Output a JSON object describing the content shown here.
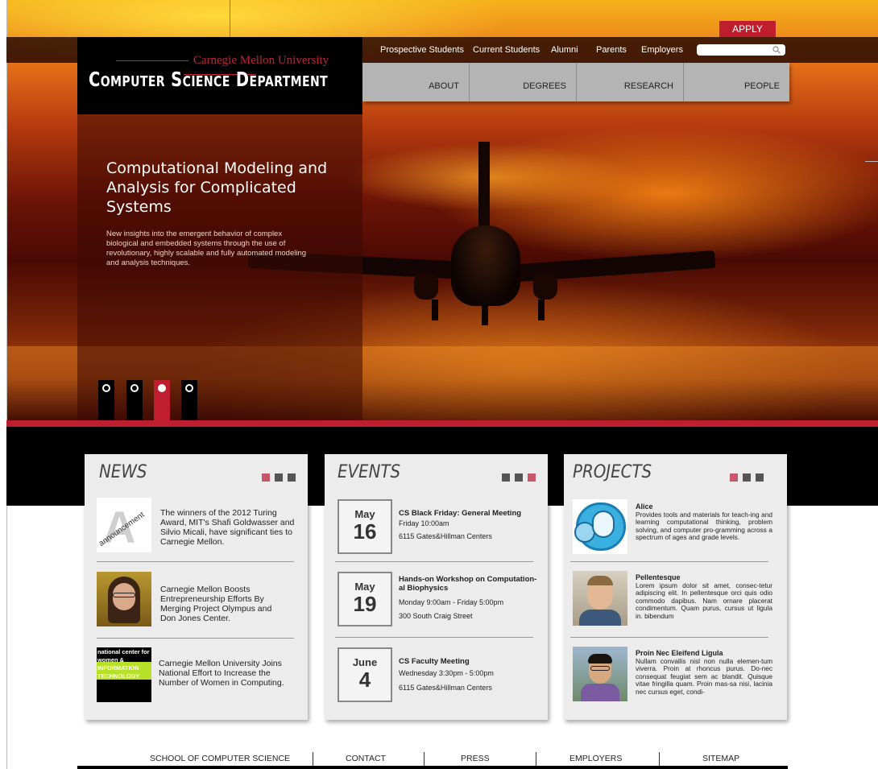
{
  "header": {
    "university": "Carnegie Mellon University",
    "department": "Computer Science Department",
    "apply_label": "APPLY",
    "audience_links": [
      "Prospective Students",
      "Current Students",
      "Alumni",
      "Parents",
      "Employers"
    ],
    "search": {
      "placeholder": ""
    },
    "nav": [
      "ABOUT",
      "DEGREES",
      "RESEARCH",
      "PEOPLE"
    ]
  },
  "feature": {
    "title": "Computational Modeling and Analysis for Complicated Systems",
    "description": "New insights into the emergent behavior of complex biological and embedded systems through the use of revolutionary, highly scalable and fully automated modeling and analysis techniques.",
    "slides": 4,
    "active_slide": 3
  },
  "news": {
    "title": "NEWS",
    "items": [
      {
        "thumb_text": "announcement",
        "text": "The winners of the 2012 Turing Award, MIT's Shafi Goldwasser and Silvio Micali, have significant ties to Carnegie Mellon."
      },
      {
        "thumb_text": "",
        "text": "Carnegie Mellon Boosts Entrepreneurship Efforts By Merging Project Olympus and Don Jones Center."
      },
      {
        "thumb_text": "national center for women & INFORMATION TECHNOLOGY",
        "text": "Carnegie Mellon University Joins National Effort to Increase the Number of Women in Computing."
      }
    ]
  },
  "events": {
    "title": "EVENTS",
    "items": [
      {
        "month": "May",
        "day": "16",
        "title": "CS Black Friday: General Meeting",
        "time": "Friday 10:00am",
        "place": "6115 Gates&Hillman Centers"
      },
      {
        "month": "May",
        "day": "19",
        "title": "Hands-on Workshop on Computation-al Biophysics",
        "time": "Monday 9:00am - Friday 5:00pm",
        "place": "300 South Craig Street"
      },
      {
        "month": "June",
        "day": "4",
        "title": "CS Faculty Meeting",
        "time": "Wednesday 3:30pm - 5:00pm",
        "place": "6115 Gates&Hillman Centers"
      }
    ]
  },
  "projects": {
    "title": "PROJECTS",
    "items": [
      {
        "name": "Alice",
        "desc": "Provides tools and materials for teach-ing and learning computational thinking, problem solving, and computer pro-gramming across a spectrum of ages and grade levels."
      },
      {
        "name": "Pellentesque",
        "desc": "Lorem ipsum dolor sit amet, consec-tetur adipiscing elit. In pellentesque orci quis odio commodo dapibus. Nam ornare placerat condimentum. Quam purus, cursus ut ligula in. bibendum"
      },
      {
        "name": "Proin Nec Eleifend Ligula",
        "desc": "Nullam convallis nisl non nulla elemen-tum viverra. Proin at rhoncus purus. Do-nec consequat feugiat sem ac blandit. Quisque vitae fringilla quam. Proin mas-sa nisi, lacinia nec cursus eget, condi-"
      }
    ]
  },
  "footer": {
    "links": [
      "SCHOOL OF COMPUTER SCIENCE",
      "CONTACT",
      "PRESS",
      "EMPLOYERS",
      "SITEMAP"
    ]
  },
  "colors": {
    "accent": "#bf1e2e",
    "nav_gray": "#b4b4b4",
    "card_bg": "#ececec",
    "square_pink": "#c9576a",
    "square_dark": "#555555"
  }
}
